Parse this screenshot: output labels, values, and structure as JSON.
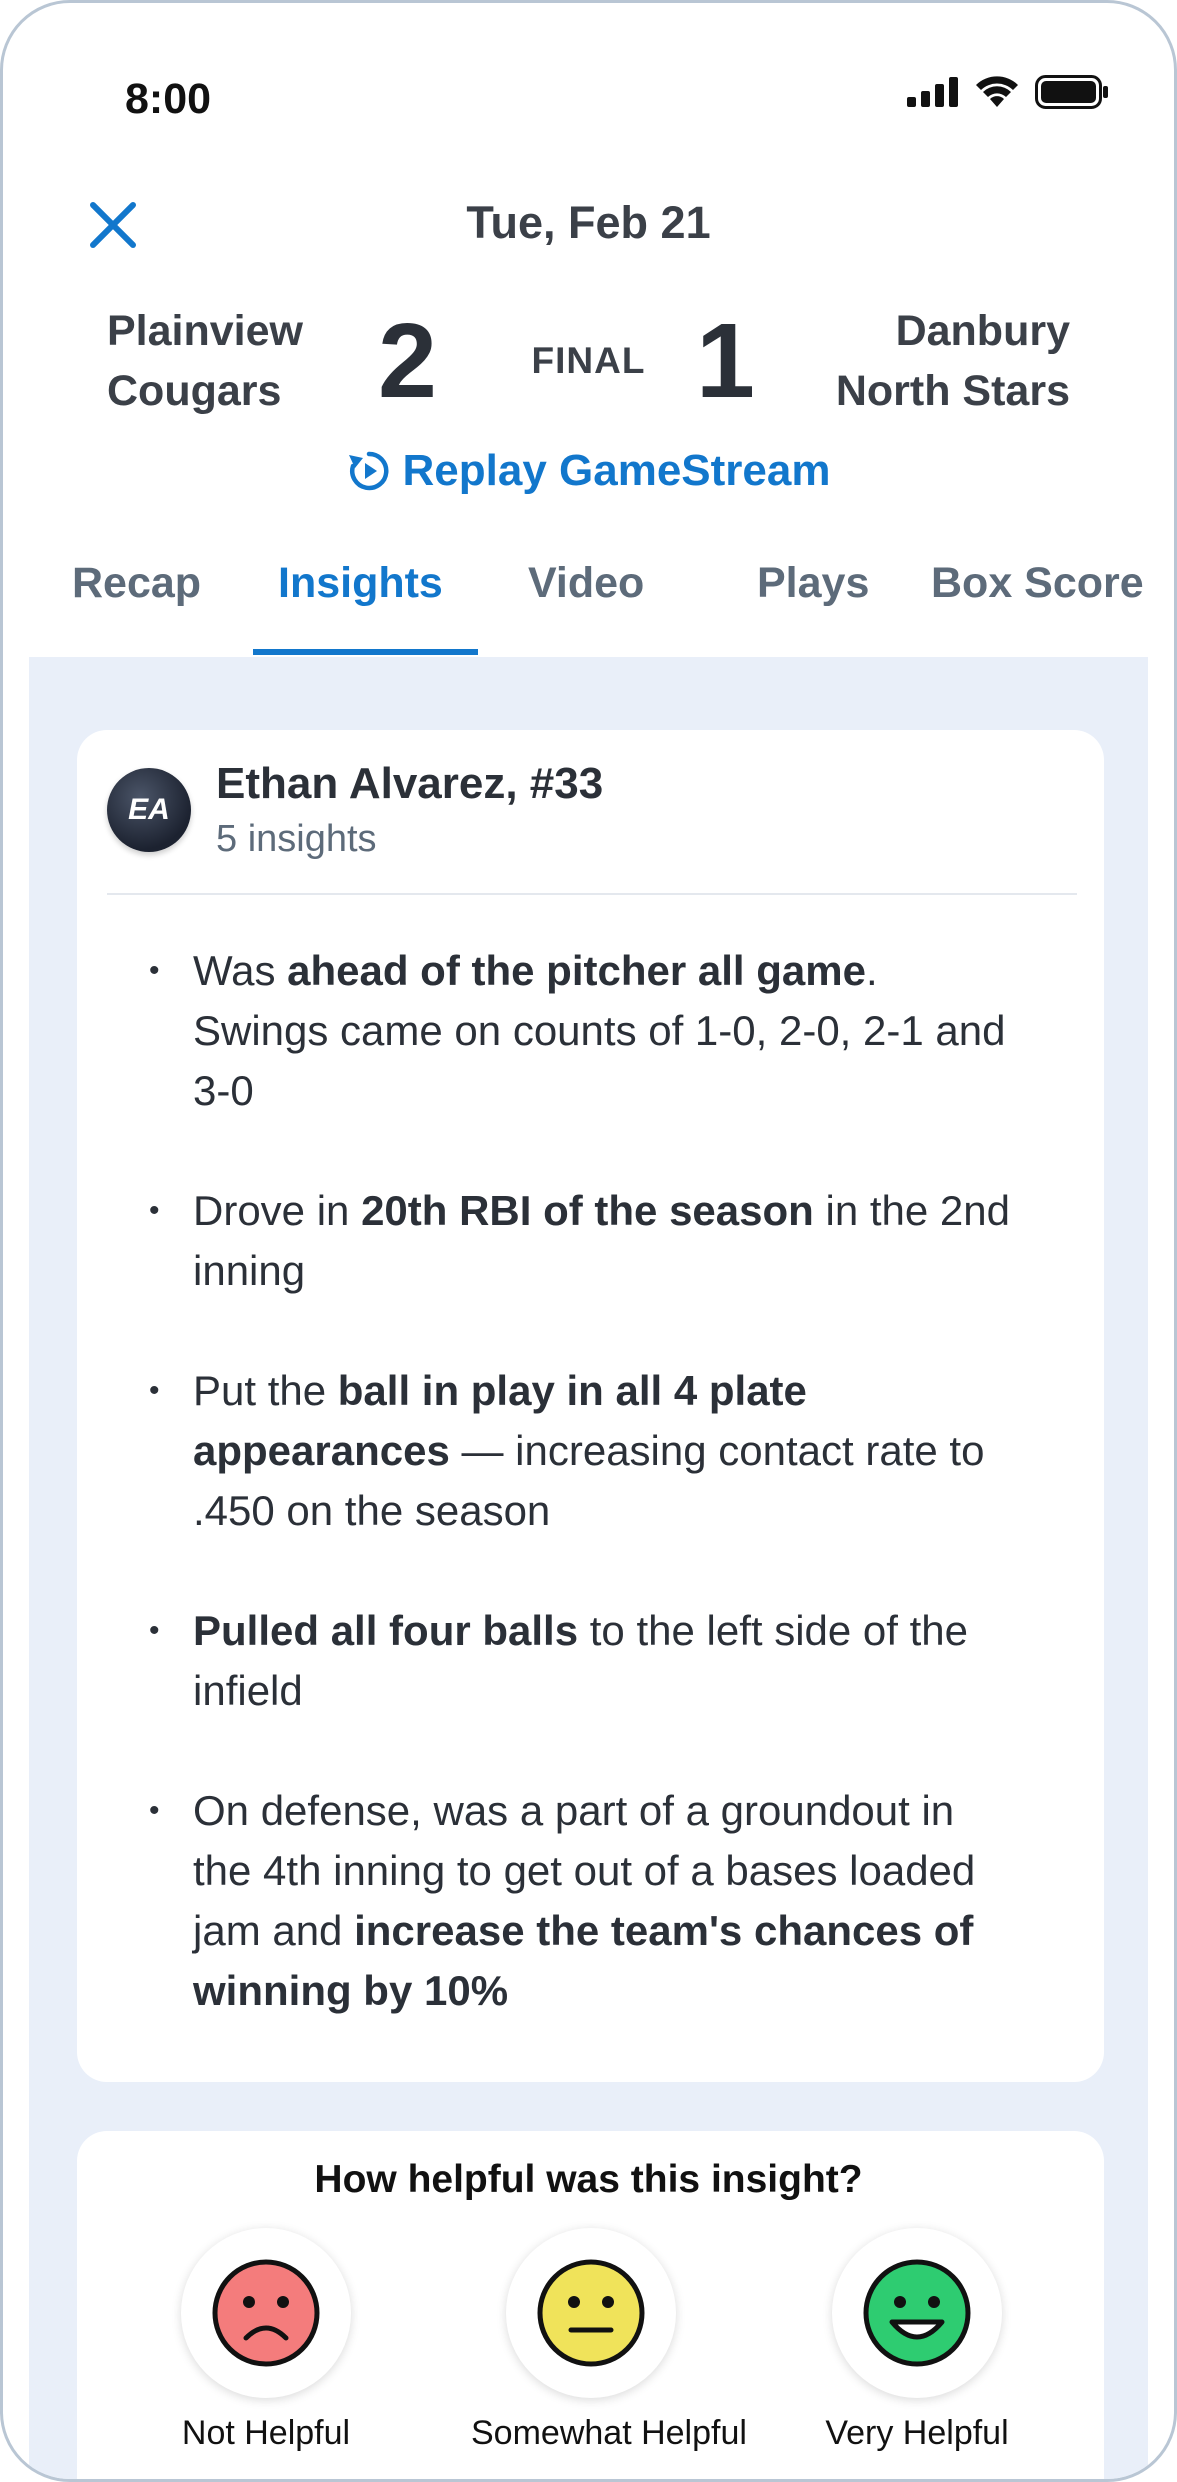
{
  "status_bar": {
    "time": "8:00"
  },
  "header": {
    "date": "Tue, Feb 21",
    "home_team": {
      "line1": "Plainview",
      "line2": "Cougars",
      "score": "2"
    },
    "away_team": {
      "line1": "Danbury",
      "line2": "North Stars",
      "score": "1"
    },
    "status": "FINAL",
    "replay_label": "Replay GameStream"
  },
  "tabs": [
    {
      "label": "Recap"
    },
    {
      "label": "Insights",
      "active": true
    },
    {
      "label": "Video"
    },
    {
      "label": "Plays"
    },
    {
      "label": "Box Score"
    }
  ],
  "player": {
    "initials": "EA",
    "name": "Ethan Alvarez, #33",
    "insight_count": "5 insights"
  },
  "insights": [
    [
      {
        "t": "Was "
      },
      {
        "t": "ahead of the pitcher all game",
        "b": true
      },
      {
        "t": ". Swings came on counts of 1-0, 2-0, 2-1 and 3-0"
      }
    ],
    [
      {
        "t": "Drove in "
      },
      {
        "t": "20th RBI of the season",
        "b": true
      },
      {
        "t": " in the 2nd inning"
      }
    ],
    [
      {
        "t": "Put the "
      },
      {
        "t": "ball in play in all 4 plate appearances",
        "b": true
      },
      {
        "t": " — increasing contact rate to .450 on the season"
      }
    ],
    [
      {
        "t": "Pulled all four balls",
        "b": true
      },
      {
        "t": " to the left side of the infield"
      }
    ],
    [
      {
        "t": "On defense, was a part of a groundout in the 4th inning to get out of a bases loaded jam and "
      },
      {
        "t": "increase the team's chances of winning by 10%",
        "b": true
      }
    ]
  ],
  "feedback": {
    "question": "How helpful was this insight?",
    "options": [
      {
        "label": "Not Helpful",
        "icon": "sad-face-icon",
        "color": "#f47c7c"
      },
      {
        "label": "Somewhat Helpful",
        "icon": "neutral-face-icon",
        "color": "#f0e35a"
      },
      {
        "label": "Very Helpful",
        "icon": "happy-face-icon",
        "color": "#2ecc71"
      }
    ]
  },
  "colors": {
    "accent": "#1277cc",
    "background": "#e9eff9"
  }
}
